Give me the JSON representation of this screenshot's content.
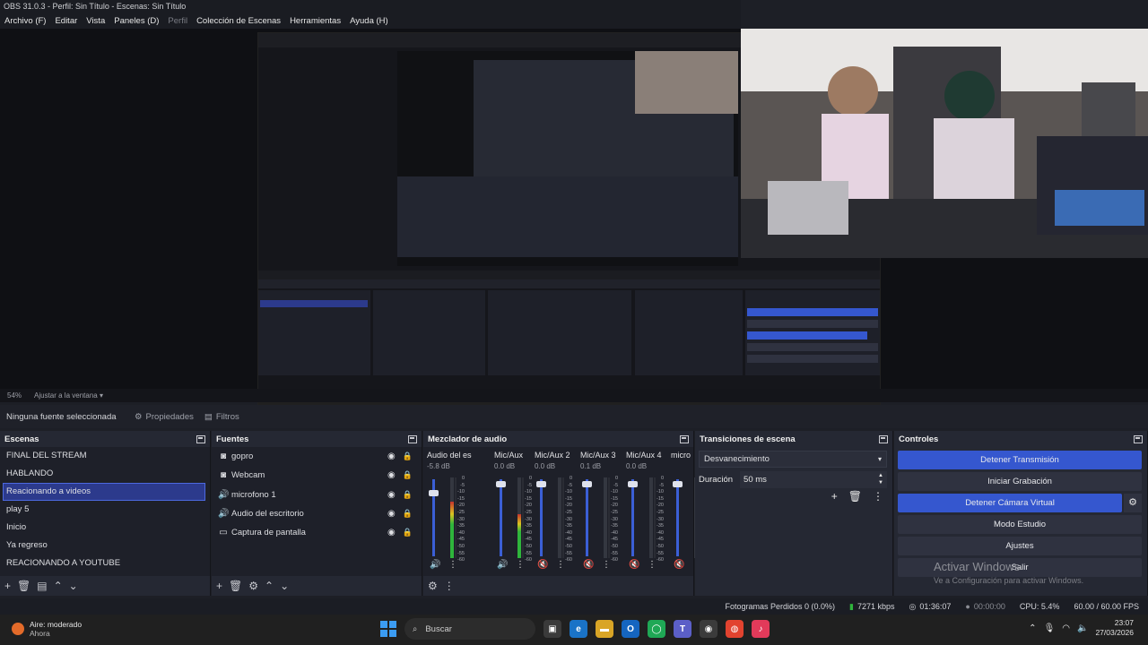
{
  "title": "OBS 31.0.3 - Perfil: Sin Título - Escenas: Sin Título",
  "menu": [
    {
      "label": "Archivo (F)",
      "disabled": false
    },
    {
      "label": "Editar",
      "disabled": false
    },
    {
      "label": "Vista",
      "disabled": false
    },
    {
      "label": "Paneles (D)",
      "disabled": false
    },
    {
      "label": "Perfil",
      "disabled": true
    },
    {
      "label": "Colección de Escenas",
      "disabled": false
    },
    {
      "label": "Herramientas",
      "disabled": false
    },
    {
      "label": "Ayuda (H)",
      "disabled": false
    }
  ],
  "preview": {
    "zoom": "54%",
    "fit_label": "Ajustar a la ventana"
  },
  "context": {
    "no_source": "Ninguna fuente seleccionada",
    "properties": "Propiedades",
    "filters": "Filtros"
  },
  "scenes": {
    "title": "Escenas",
    "items": [
      "FINAL DEL STREAM",
      "HABLANDO",
      "Reacionando a videos",
      "play 5",
      "Inicio",
      "Ya regreso",
      "REACIONANDO A YOUTUBE"
    ],
    "selected_index": 2
  },
  "sources": {
    "title": "Fuentes",
    "items": [
      {
        "name": "gopro",
        "icon": "camera-icon"
      },
      {
        "name": "Webcam",
        "icon": "camera-icon"
      },
      {
        "name": "microfono 1",
        "icon": "speaker-icon"
      },
      {
        "name": "Audio del escritorio",
        "icon": "speaker-icon"
      },
      {
        "name": "Captura de pantalla",
        "icon": "monitor-icon"
      }
    ]
  },
  "mixer": {
    "title": "Mezclador de audio",
    "channels": [
      {
        "name": "Audio del escritorio",
        "db": "-5.8 dB",
        "level": 0.7,
        "muted": false
      },
      {
        "name": "Mic/Aux",
        "db": "0.0 dB",
        "level": 0.55,
        "muted": false
      },
      {
        "name": "Mic/Aux 2",
        "db": "0.0 dB",
        "level": 0.0,
        "muted": true
      },
      {
        "name": "Mic/Aux 3",
        "db": "0.1 dB",
        "level": 0.0,
        "muted": true
      },
      {
        "name": "Mic/Aux 4",
        "db": "0.0 dB",
        "level": 0.0,
        "muted": true
      },
      {
        "name": "micro",
        "db": "",
        "level": 0.0,
        "muted": true
      }
    ],
    "scale": [
      "0",
      "-5",
      "-10",
      "-15",
      "-20",
      "-25",
      "-30",
      "-35",
      "-40",
      "-45",
      "-50",
      "-55",
      "-60"
    ]
  },
  "transitions": {
    "title": "Transiciones de escena",
    "selected": "Desvanecimiento",
    "duration_label": "Duración",
    "duration_value": "50 ms"
  },
  "controls": {
    "title": "Controles",
    "stop_stream": "Detener Transmisión",
    "start_recording": "Iniciar Grabación",
    "stop_virtual_cam": "Detener Cámara Virtual",
    "studio_mode": "Modo Estudio",
    "settings": "Ajustes",
    "exit": "Salir"
  },
  "watermark": {
    "line1": "Activar Windows",
    "line2": "Ve a Configuración para activar Windows."
  },
  "stats": {
    "dropped": "Fotogramas Perdidos 0 (0.0%)",
    "bitrate": "7271 kbps",
    "stream_time": "01:36:07",
    "rec_time": "00:00:00",
    "cpu": "CPU: 5.4%",
    "fps": "60.00 / 60.00 FPS"
  },
  "taskbar": {
    "weather_line1": "Aire: moderado",
    "weather_line2": "Ahora",
    "search_placeholder": "Buscar",
    "time": "23:07",
    "date": "27/03/2026"
  },
  "colors": {
    "accent": "#3557cf",
    "meter_green": "#2fb53c",
    "muted_red": "#c8343a"
  }
}
